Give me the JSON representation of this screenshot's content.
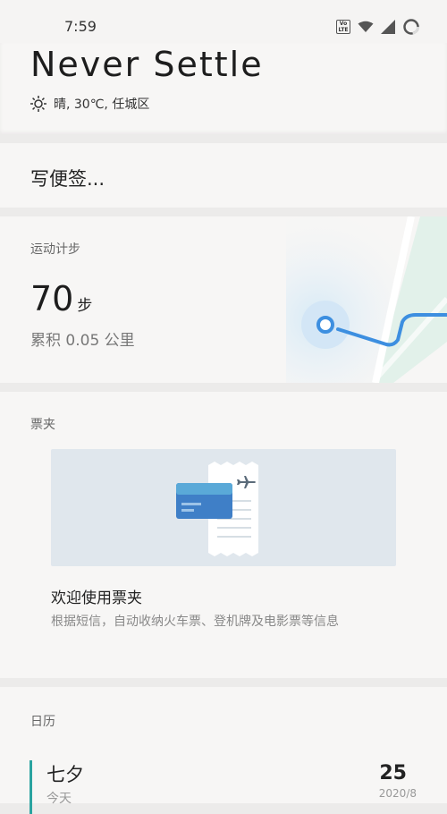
{
  "status_bar": {
    "time": "7:59",
    "volte_text": "Vo LTE"
  },
  "header": {
    "title": "Never Settle",
    "weather": "晴, 30℃, 任城区"
  },
  "note": {
    "placeholder": "写便签..."
  },
  "steps": {
    "section_title": "运动计步",
    "count": "70",
    "unit": "步",
    "distance": "累积 0.05 公里"
  },
  "tickets": {
    "section_title": "票夹",
    "welcome_title": "欢迎使用票夹",
    "welcome_desc": "根据短信，自动收纳火车票、登机牌及电影票等信息"
  },
  "calendar": {
    "section_title": "日历",
    "event_name": "七夕",
    "event_sub": "今天",
    "day": "25",
    "date": "2020/8"
  },
  "colors": {
    "accent_teal": "#2aa3a0",
    "route_blue": "#3d8fe0",
    "ticket_card_blue": "#3f7fc7"
  }
}
